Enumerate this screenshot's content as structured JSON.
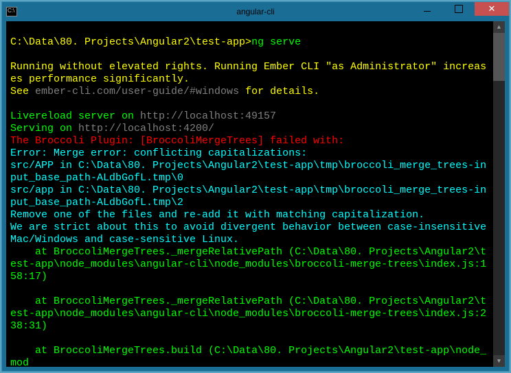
{
  "window": {
    "title": "angular-cli",
    "icon_glyph": "C:\\"
  },
  "prompt": {
    "path": "C:\\Data\\80. Projects\\Angular2\\test-app>",
    "command": "ng serve"
  },
  "lines": {
    "warn1": "Running without elevated rights. Running Ember CLI \"as Administrator\" increases performance significantly.",
    "warn2a": "See ",
    "warn2b": "ember-cli.com/user-guide/#windows",
    "warn2c": " for details.",
    "live1a": "Livereload server on ",
    "live1b": "http://localhost:49157",
    "serve1a": "Serving on ",
    "serve1b": "http://localhost:4200/",
    "err1": "The Broccoli Plugin: [BroccoliMergeTrees] failed with:",
    "err2": "Error: Merge error: conflicting capitalizations:",
    "err3": "src/APP in C:\\Data\\80. Projects\\Angular2\\test-app\\tmp\\broccoli_merge_trees-input_base_path-ALdbGofL.tmp\\0",
    "err4": "src/app in C:\\Data\\80. Projects\\Angular2\\test-app\\tmp\\broccoli_merge_trees-input_base_path-ALdbGofL.tmp\\2",
    "err5": "Remove one of the files and re-add it with matching capitalization.",
    "err6": "We are strict about this to avoid divergent behavior between case-insensitive Mac/Windows and case-sensitive Linux.",
    "trace1": "    at BroccoliMergeTrees._mergeRelativePath (C:\\Data\\80. Projects\\Angular2\\test-app\\node_modules\\angular-cli\\node_modules\\broccoli-merge-trees\\index.js:158:17)",
    "trace2": "    at BroccoliMergeTrees._mergeRelativePath (C:\\Data\\80. Projects\\Angular2\\test-app\\node_modules\\angular-cli\\node_modules\\broccoli-merge-trees\\index.js:238:31)",
    "trace3": "    at BroccoliMergeTrees.build (C:\\Data\\80. Projects\\Angular2\\test-app\\node_mod"
  }
}
